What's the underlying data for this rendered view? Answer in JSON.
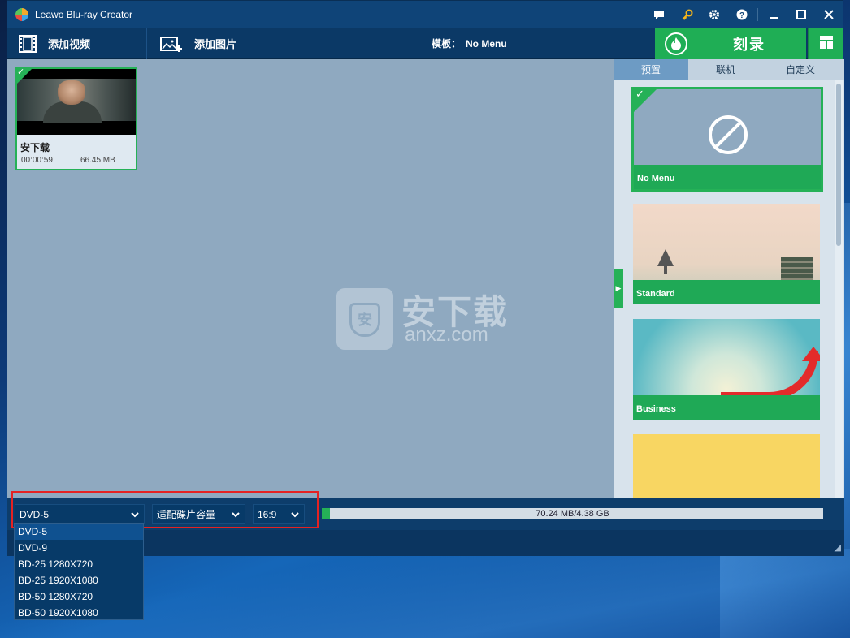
{
  "window": {
    "title": "Leawo Blu-ray Creator"
  },
  "toolbar": {
    "add_video": "添加视频",
    "add_image": "添加图片",
    "template_label": "模板：",
    "template_value": "No Menu",
    "burn": "刻录"
  },
  "video": {
    "name": "安下载",
    "duration": "00:00:59",
    "size": "66.45 MB"
  },
  "watermark": {
    "title": "安下载",
    "sub": "anxz.com",
    "badge": "安"
  },
  "panel": {
    "tabs": [
      "预置",
      "联机",
      "自定义"
    ],
    "templates": [
      {
        "label": "No Menu"
      },
      {
        "label": "Standard"
      },
      {
        "label": "Business"
      },
      {
        "label": ""
      }
    ]
  },
  "bottom": {
    "disc": "DVD-5",
    "fit": "适配碟片容量",
    "ratio": "16:9",
    "capacity": "70.24 MB/4.38 GB",
    "capacity_fraction": 0.016
  },
  "disc_options": [
    "DVD-5",
    "DVD-9",
    "BD-25 1280X720",
    "BD-25 1920X1080",
    "BD-50 1280X720",
    "BD-50 1920X1080"
  ],
  "colors": {
    "accent_green": "#25b157",
    "highlight_red": "#e52222"
  }
}
